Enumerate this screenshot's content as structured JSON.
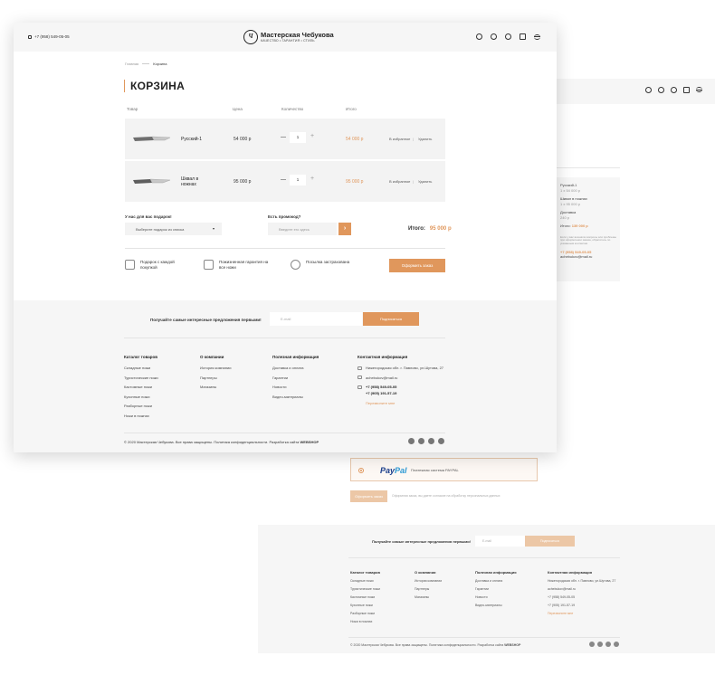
{
  "header": {
    "phone": "+7 (958) 549-05-05",
    "logo_mark": "Ч",
    "logo_name": "Мастерская Чебукова",
    "logo_slogan": "КАЧЕСТВО • ГАРАНТИЯ • СТИЛЬ",
    "icons": [
      "search-icon",
      "heart-icon",
      "user-icon",
      "bag-icon",
      "menu-icon"
    ]
  },
  "breadcrumb": {
    "home": "Главная",
    "current": "Корзина"
  },
  "page_title": "КОРЗИНА",
  "table": {
    "headers": [
      "Товар",
      "Цена",
      "Количество",
      "Итого"
    ],
    "rows": [
      {
        "name": "Русский-1",
        "price": "54 000 р",
        "qty": "1",
        "total": "54 000 р",
        "fav": "В избранное",
        "sep": "|",
        "del": "Удалить"
      },
      {
        "name": "Шквал в ножнах",
        "price": "95 000 р",
        "qty": "1",
        "total": "95 000 р",
        "fav": "В избранное",
        "sep": "|",
        "del": "Удалить"
      }
    ]
  },
  "gift": {
    "label": "У нас для вас подарок!",
    "placeholder": "Выберите подарок из списка"
  },
  "promo": {
    "label": "Есть промокод?",
    "placeholder": "Введите его здесь",
    "button": "›"
  },
  "grand_total": {
    "label": "Итого:",
    "value": "95 000 р"
  },
  "features": [
    "Подарок с каждой покупкой",
    "Пожизненная гарантия на все ножи",
    "Посылка застрахована"
  ],
  "checkout_button": "Оформить заказ",
  "newsletter": {
    "title": "Получайте самые интересные предложения первыми!",
    "placeholder": "E-mail",
    "button": "Подписаться"
  },
  "footer": {
    "catalog": {
      "title": "Каталог товаров",
      "items": [
        "Складные ножи",
        "Туристические ножи",
        "Кастомные ножи",
        "Кухонные ножи",
        "Разборные ножи",
        "Ножи в ножнах"
      ]
    },
    "about": {
      "title": "О компании",
      "items": [
        "История компании",
        "Партнеры",
        "Магазины"
      ]
    },
    "info": {
      "title": "Полезная информация",
      "items": [
        "Доставка и оплата",
        "Гарантии",
        "Новости",
        "Видео-материалы"
      ]
    },
    "contacts": {
      "title": "Контактная информация",
      "address": "Нижегородская обл. г. Павлово, ул.Шутова, 27",
      "email": "achebukov@mail.ru",
      "phone1": "+7 (958) 549-05-05",
      "phone2": "+7 (905) 191-57-19",
      "callback": "Перезвоните мне"
    },
    "copyright": "© 2020 Мастерская Чебукова. Все права защищены. Политика конфиденциальности.",
    "dev": "Разработка сайта",
    "dev_brand": "WEBSHOP"
  },
  "back_summary": {
    "item1": "Русский-1",
    "item1_sub": "1 x 54 000 р",
    "item2": "Шквал в ножнах",
    "item2_sub": "1 x 95 000 р",
    "delivery": "Доставка",
    "delivery_sub": "240 р",
    "total_label": "Итого:",
    "total": "139 000 р",
    "help_text": "Если у вас возникли вопросы или проблемы при оформлении заказа, обратитесь по указанным контактам",
    "phone": "+7 (958) 549-05-05",
    "email": "achebukov@mail.ru"
  },
  "payment": {
    "logo_pay": "Pay",
    "logo_pal": "Pal",
    "text": "Платежная система PAYPAL",
    "button": "Оформить заказ",
    "agree": "Оформляя заказ, вы даете согласие на обработку персональных данных"
  },
  "back_footer": {
    "news_title": "Получайте самые интересные предложения первыми!",
    "placeholder": "E-mail",
    "button": "Подписаться",
    "catalog": {
      "title": "Каталог товаров",
      "items": [
        "Складные ножи",
        "Туристические ножи",
        "Кастомные ножи",
        "Кухонные ножи",
        "Разборные ножи",
        "Ножи в ножнах"
      ]
    },
    "about": {
      "title": "О компании",
      "items": [
        "История компании",
        "Партнеры",
        "Магазины"
      ]
    },
    "info": {
      "title": "Полезная информация",
      "items": [
        "Доставка и оплата",
        "Гарантии",
        "Новости",
        "Видео-материалы"
      ]
    },
    "contacts": {
      "title": "Контактная информация",
      "address": "Нижегородская обл. г. Павлово, ул.Шутова, 27",
      "email": "achebukov@mail.ru",
      "phone1": "+7 (958) 549-05-05",
      "phone2": "+7 (905) 191-57-19",
      "callback": "Перезвоните мне"
    },
    "copyright": "© 2020 Мастерская Чебукова. Все права защищены. Политика конфиденциальности.",
    "dev": "Разработка сайта",
    "dev_brand": "WEBSHOP"
  },
  "colors": {
    "accent": "#e0975c",
    "accent_light": "#ecc7a6",
    "panel": "#f6f6f6",
    "row": "#f3f3f3"
  }
}
